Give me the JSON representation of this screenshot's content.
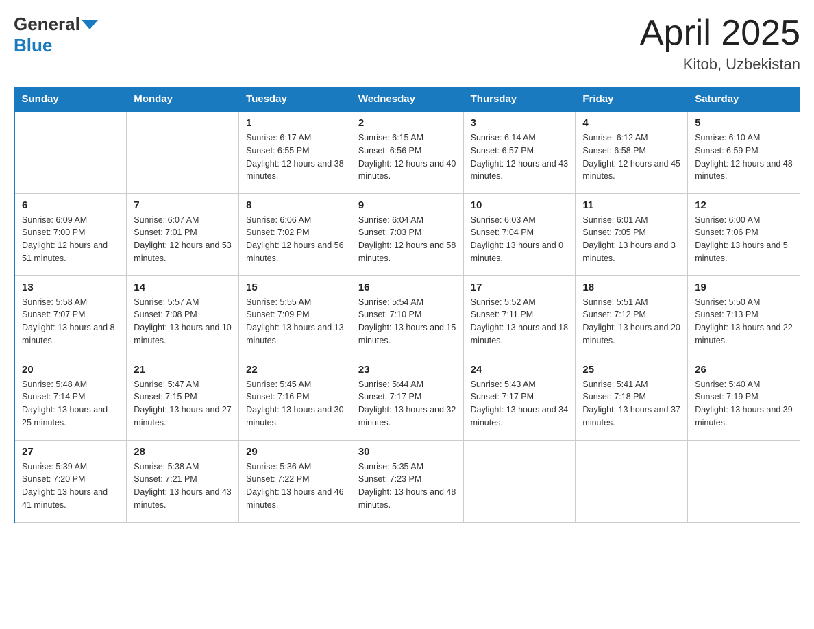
{
  "header": {
    "logo_general": "General",
    "logo_blue": "Blue",
    "title": "April 2025",
    "subtitle": "Kitob, Uzbekistan"
  },
  "days_of_week": [
    "Sunday",
    "Monday",
    "Tuesday",
    "Wednesday",
    "Thursday",
    "Friday",
    "Saturday"
  ],
  "weeks": [
    [
      {
        "day": "",
        "sunrise": "",
        "sunset": "",
        "daylight": ""
      },
      {
        "day": "",
        "sunrise": "",
        "sunset": "",
        "daylight": ""
      },
      {
        "day": "1",
        "sunrise": "Sunrise: 6:17 AM",
        "sunset": "Sunset: 6:55 PM",
        "daylight": "Daylight: 12 hours and 38 minutes."
      },
      {
        "day": "2",
        "sunrise": "Sunrise: 6:15 AM",
        "sunset": "Sunset: 6:56 PM",
        "daylight": "Daylight: 12 hours and 40 minutes."
      },
      {
        "day": "3",
        "sunrise": "Sunrise: 6:14 AM",
        "sunset": "Sunset: 6:57 PM",
        "daylight": "Daylight: 12 hours and 43 minutes."
      },
      {
        "day": "4",
        "sunrise": "Sunrise: 6:12 AM",
        "sunset": "Sunset: 6:58 PM",
        "daylight": "Daylight: 12 hours and 45 minutes."
      },
      {
        "day": "5",
        "sunrise": "Sunrise: 6:10 AM",
        "sunset": "Sunset: 6:59 PM",
        "daylight": "Daylight: 12 hours and 48 minutes."
      }
    ],
    [
      {
        "day": "6",
        "sunrise": "Sunrise: 6:09 AM",
        "sunset": "Sunset: 7:00 PM",
        "daylight": "Daylight: 12 hours and 51 minutes."
      },
      {
        "day": "7",
        "sunrise": "Sunrise: 6:07 AM",
        "sunset": "Sunset: 7:01 PM",
        "daylight": "Daylight: 12 hours and 53 minutes."
      },
      {
        "day": "8",
        "sunrise": "Sunrise: 6:06 AM",
        "sunset": "Sunset: 7:02 PM",
        "daylight": "Daylight: 12 hours and 56 minutes."
      },
      {
        "day": "9",
        "sunrise": "Sunrise: 6:04 AM",
        "sunset": "Sunset: 7:03 PM",
        "daylight": "Daylight: 12 hours and 58 minutes."
      },
      {
        "day": "10",
        "sunrise": "Sunrise: 6:03 AM",
        "sunset": "Sunset: 7:04 PM",
        "daylight": "Daylight: 13 hours and 0 minutes."
      },
      {
        "day": "11",
        "sunrise": "Sunrise: 6:01 AM",
        "sunset": "Sunset: 7:05 PM",
        "daylight": "Daylight: 13 hours and 3 minutes."
      },
      {
        "day": "12",
        "sunrise": "Sunrise: 6:00 AM",
        "sunset": "Sunset: 7:06 PM",
        "daylight": "Daylight: 13 hours and 5 minutes."
      }
    ],
    [
      {
        "day": "13",
        "sunrise": "Sunrise: 5:58 AM",
        "sunset": "Sunset: 7:07 PM",
        "daylight": "Daylight: 13 hours and 8 minutes."
      },
      {
        "day": "14",
        "sunrise": "Sunrise: 5:57 AM",
        "sunset": "Sunset: 7:08 PM",
        "daylight": "Daylight: 13 hours and 10 minutes."
      },
      {
        "day": "15",
        "sunrise": "Sunrise: 5:55 AM",
        "sunset": "Sunset: 7:09 PM",
        "daylight": "Daylight: 13 hours and 13 minutes."
      },
      {
        "day": "16",
        "sunrise": "Sunrise: 5:54 AM",
        "sunset": "Sunset: 7:10 PM",
        "daylight": "Daylight: 13 hours and 15 minutes."
      },
      {
        "day": "17",
        "sunrise": "Sunrise: 5:52 AM",
        "sunset": "Sunset: 7:11 PM",
        "daylight": "Daylight: 13 hours and 18 minutes."
      },
      {
        "day": "18",
        "sunrise": "Sunrise: 5:51 AM",
        "sunset": "Sunset: 7:12 PM",
        "daylight": "Daylight: 13 hours and 20 minutes."
      },
      {
        "day": "19",
        "sunrise": "Sunrise: 5:50 AM",
        "sunset": "Sunset: 7:13 PM",
        "daylight": "Daylight: 13 hours and 22 minutes."
      }
    ],
    [
      {
        "day": "20",
        "sunrise": "Sunrise: 5:48 AM",
        "sunset": "Sunset: 7:14 PM",
        "daylight": "Daylight: 13 hours and 25 minutes."
      },
      {
        "day": "21",
        "sunrise": "Sunrise: 5:47 AM",
        "sunset": "Sunset: 7:15 PM",
        "daylight": "Daylight: 13 hours and 27 minutes."
      },
      {
        "day": "22",
        "sunrise": "Sunrise: 5:45 AM",
        "sunset": "Sunset: 7:16 PM",
        "daylight": "Daylight: 13 hours and 30 minutes."
      },
      {
        "day": "23",
        "sunrise": "Sunrise: 5:44 AM",
        "sunset": "Sunset: 7:17 PM",
        "daylight": "Daylight: 13 hours and 32 minutes."
      },
      {
        "day": "24",
        "sunrise": "Sunrise: 5:43 AM",
        "sunset": "Sunset: 7:17 PM",
        "daylight": "Daylight: 13 hours and 34 minutes."
      },
      {
        "day": "25",
        "sunrise": "Sunrise: 5:41 AM",
        "sunset": "Sunset: 7:18 PM",
        "daylight": "Daylight: 13 hours and 37 minutes."
      },
      {
        "day": "26",
        "sunrise": "Sunrise: 5:40 AM",
        "sunset": "Sunset: 7:19 PM",
        "daylight": "Daylight: 13 hours and 39 minutes."
      }
    ],
    [
      {
        "day": "27",
        "sunrise": "Sunrise: 5:39 AM",
        "sunset": "Sunset: 7:20 PM",
        "daylight": "Daylight: 13 hours and 41 minutes."
      },
      {
        "day": "28",
        "sunrise": "Sunrise: 5:38 AM",
        "sunset": "Sunset: 7:21 PM",
        "daylight": "Daylight: 13 hours and 43 minutes."
      },
      {
        "day": "29",
        "sunrise": "Sunrise: 5:36 AM",
        "sunset": "Sunset: 7:22 PM",
        "daylight": "Daylight: 13 hours and 46 minutes."
      },
      {
        "day": "30",
        "sunrise": "Sunrise: 5:35 AM",
        "sunset": "Sunset: 7:23 PM",
        "daylight": "Daylight: 13 hours and 48 minutes."
      },
      {
        "day": "",
        "sunrise": "",
        "sunset": "",
        "daylight": ""
      },
      {
        "day": "",
        "sunrise": "",
        "sunset": "",
        "daylight": ""
      },
      {
        "day": "",
        "sunrise": "",
        "sunset": "",
        "daylight": ""
      }
    ]
  ]
}
